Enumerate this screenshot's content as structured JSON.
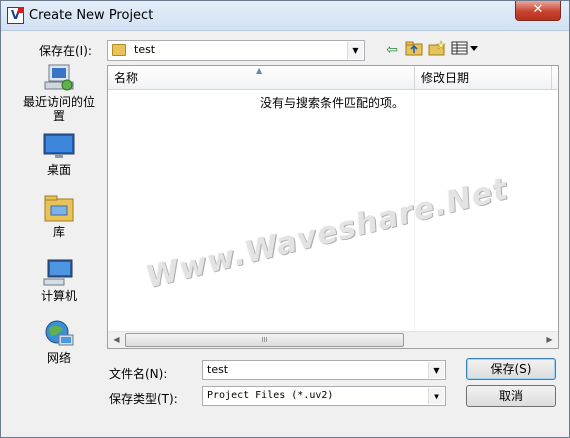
{
  "window": {
    "title": "Create New Project",
    "close_label": "✕"
  },
  "save_in": {
    "label": "保存在(I):",
    "value": "test"
  },
  "places": [
    {
      "label": "最近访问的位置"
    },
    {
      "label": "桌面"
    },
    {
      "label": "库"
    },
    {
      "label": "计算机"
    },
    {
      "label": "网络"
    }
  ],
  "list": {
    "columns": [
      "名称",
      "修改日期"
    ],
    "empty_message": "没有与搜索条件匹配的项。",
    "scroll_grip": "III"
  },
  "file_name": {
    "label": "文件名(N):",
    "value": "test"
  },
  "file_type": {
    "label": "保存类型(T):",
    "value": "Project Files (*.uv2)"
  },
  "buttons": {
    "save": "保存(S)",
    "cancel": "取消"
  },
  "watermark": "Www.Waveshare.Net",
  "colors": {
    "accent": "#3c7fb1",
    "close": "#c7432f"
  }
}
